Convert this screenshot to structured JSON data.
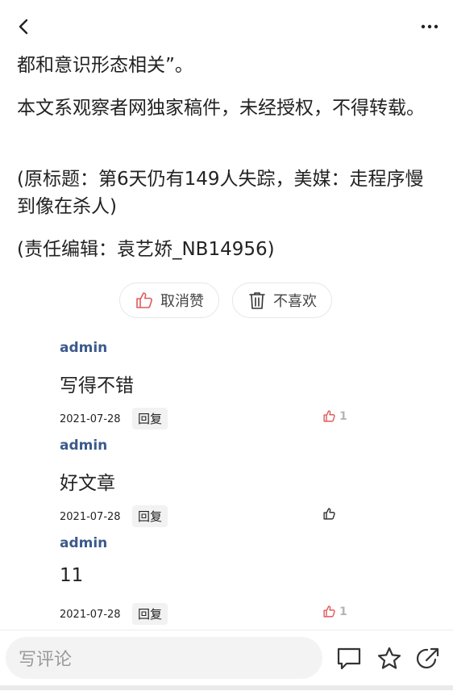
{
  "header": {
    "back_icon": "chevron-left-icon",
    "more_icon": "more-dots-icon"
  },
  "article": {
    "paragraphs": [
      "都和意识形态相关”。",
      "本文系观察者网独家稿件，未经授权，不得转载。",
      "(原标题：第6天仍有149人失踪，美媒：走程序慢到像在杀人)",
      "(责任编辑：袁艺娇_NB14956)"
    ]
  },
  "actions": {
    "like_label": "取消赞",
    "dislike_label": "不喜欢",
    "like_color": "#e05a5a"
  },
  "comments": [
    {
      "user": "admin",
      "text": "写得不错",
      "date": "2021-07-28",
      "reply_label": "回复",
      "likes": "1",
      "liked": true
    },
    {
      "user": "admin",
      "text": "好文章",
      "date": "2021-07-28",
      "reply_label": "回复",
      "likes": "",
      "liked": false
    },
    {
      "user": "admin",
      "text": "11",
      "date": "2021-07-28",
      "reply_label": "回复",
      "likes": "1",
      "liked": true
    }
  ],
  "bottombar": {
    "input_placeholder": "写评论",
    "icons": [
      "comment-icon",
      "star-icon",
      "share-icon"
    ]
  }
}
